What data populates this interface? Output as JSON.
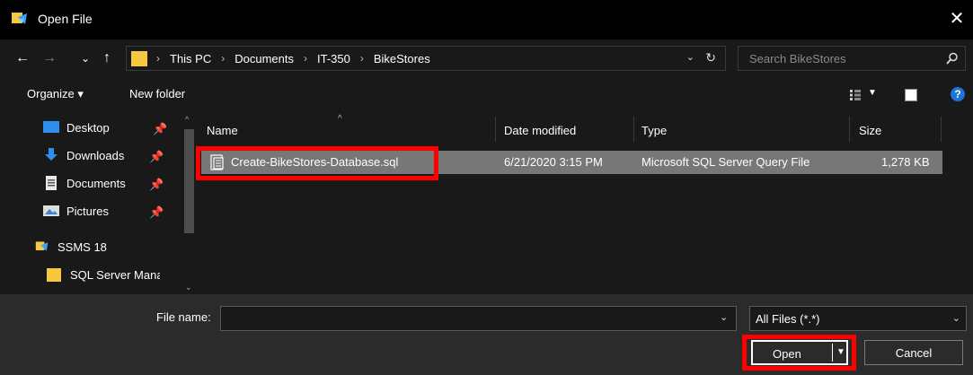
{
  "window": {
    "title": "Open File",
    "close_glyph": "✕"
  },
  "nav": {
    "back_glyph": "←",
    "forward_glyph": "→",
    "recent_glyph": "⌄",
    "up_glyph": "↑",
    "breadcrumb": [
      "This PC",
      "Documents",
      "IT-350",
      "BikeStores"
    ],
    "separator": "›",
    "dropdown_glyph": "⌄",
    "refresh_glyph": "↻"
  },
  "search": {
    "placeholder": "Search BikeStores"
  },
  "toolbar": {
    "organize_label": "Organize ▾",
    "new_folder_label": "New folder",
    "help_glyph": "?"
  },
  "sidebar": {
    "items": [
      {
        "label": "Desktop",
        "icon": "desktop-icon",
        "pinned": true
      },
      {
        "label": "Downloads",
        "icon": "downloads-icon",
        "pinned": true
      },
      {
        "label": "Documents",
        "icon": "documents-icon",
        "pinned": true
      },
      {
        "label": "Pictures",
        "icon": "pictures-icon",
        "pinned": true
      },
      {
        "label": "SSMS 18",
        "icon": "ssms-icon",
        "pinned": false
      },
      {
        "label": "SQL Server Mana",
        "icon": "folder-icon",
        "pinned": false
      }
    ],
    "pin_glyph": "📌"
  },
  "file_list": {
    "columns": [
      "Name",
      "Date modified",
      "Type",
      "Size"
    ],
    "rows": [
      {
        "name": "Create-BikeStores-Database.sql",
        "date_modified": "6/21/2020 3:15 PM",
        "type": "Microsoft SQL Server Query File",
        "size": "1,278 KB",
        "selected": true
      }
    ]
  },
  "footer": {
    "file_name_label": "File name:",
    "file_name_value": "",
    "filter_value": "All Files (*.*)",
    "open_label": "Open",
    "cancel_label": "Cancel"
  },
  "colors": {
    "highlight": "#ff0000",
    "selection": "#777777",
    "folder": "#f5c842",
    "download_arrow": "#2f8ff0"
  }
}
